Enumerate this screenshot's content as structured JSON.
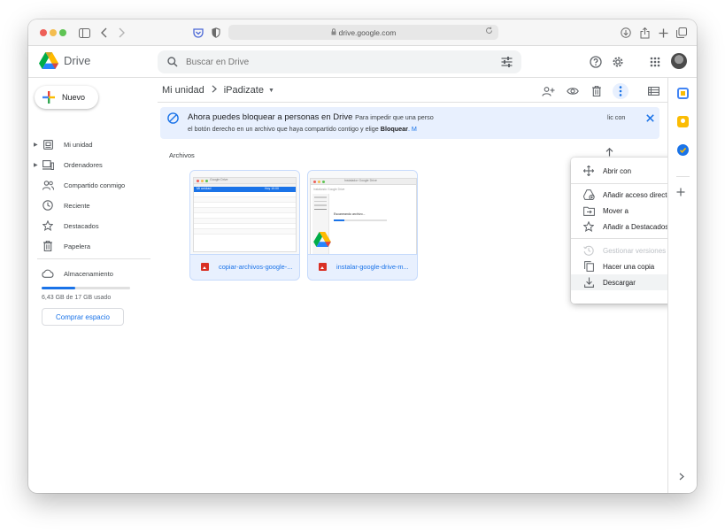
{
  "browser": {
    "url": "drive.google.com",
    "icons": [
      "sidebar-toggle-icon",
      "back-icon",
      "forward-icon",
      "pocket-icon",
      "privacy-shield-icon",
      "lock-icon",
      "reload-icon",
      "download-icon",
      "share-icon",
      "new-tab-icon",
      "tabs-overview-icon"
    ]
  },
  "app": {
    "name": "Drive"
  },
  "search": {
    "placeholder": "Buscar en Drive"
  },
  "sidebar": {
    "new_label": "Nuevo",
    "items": [
      {
        "label": "Mi unidad",
        "icon": "my-drive-icon",
        "expandable": true
      },
      {
        "label": "Ordenadores",
        "icon": "computers-icon",
        "expandable": true
      },
      {
        "label": "Compartido conmigo",
        "icon": "shared-icon",
        "expandable": false
      },
      {
        "label": "Reciente",
        "icon": "clock-icon",
        "expandable": false
      },
      {
        "label": "Destacados",
        "icon": "star-icon",
        "expandable": false
      },
      {
        "label": "Papelera",
        "icon": "trash-icon",
        "expandable": false
      }
    ],
    "storage": {
      "label": "Almacenamiento",
      "usage_text": "6,43 GB de 17 GB usado",
      "used_fraction": 0.378,
      "buy_label": "Comprar espacio"
    }
  },
  "breadcrumb": {
    "root": "Mi unidad",
    "current": "iPadizate"
  },
  "banner": {
    "title": "Ahora puedes bloquear a personas en Drive",
    "body_intro": "Para impedir que una perso",
    "body_tail": "lic con",
    "line2_before": "el botón derecho en un archivo que haya compartido contigo y elige ",
    "line2_bold": "Bloquear",
    "line2_after": ". M"
  },
  "files_section": {
    "title": "Archivos"
  },
  "files": [
    {
      "name": "copiar-archivos-google-..."
    },
    {
      "name": "instalar-google-drive-m..."
    }
  ],
  "thumbnails": {
    "file1": {
      "app_title": "Google Drive",
      "selected_row": "Mi unidad",
      "row_right": "Hoy 10:00"
    },
    "file2": {
      "app_title": "Instalador Google Drive",
      "subtitle": "Instalando Google Drive",
      "status": "Escaneando archivo..."
    }
  },
  "context_menu": {
    "items": [
      {
        "label": "Abrir con",
        "icon": "open-with-icon",
        "submenu": true
      },
      {
        "label": "Añadir acceso directo a Drive",
        "icon": "add-shortcut-icon",
        "help": true
      },
      {
        "label": "Mover a",
        "icon": "move-to-icon"
      },
      {
        "label": "Añadir a Destacados",
        "icon": "star-outline-icon"
      },
      {
        "label": "Gestionar versiones",
        "icon": "versions-icon",
        "disabled": true
      },
      {
        "label": "Hacer una copia",
        "icon": "copy-icon"
      },
      {
        "label": "Descargar",
        "icon": "download-icon",
        "highlighted": true
      }
    ]
  },
  "colors": {
    "accent": "#1a73e8",
    "banner_bg": "#e8f0fe",
    "selection_bg": "#e8f0fe"
  }
}
